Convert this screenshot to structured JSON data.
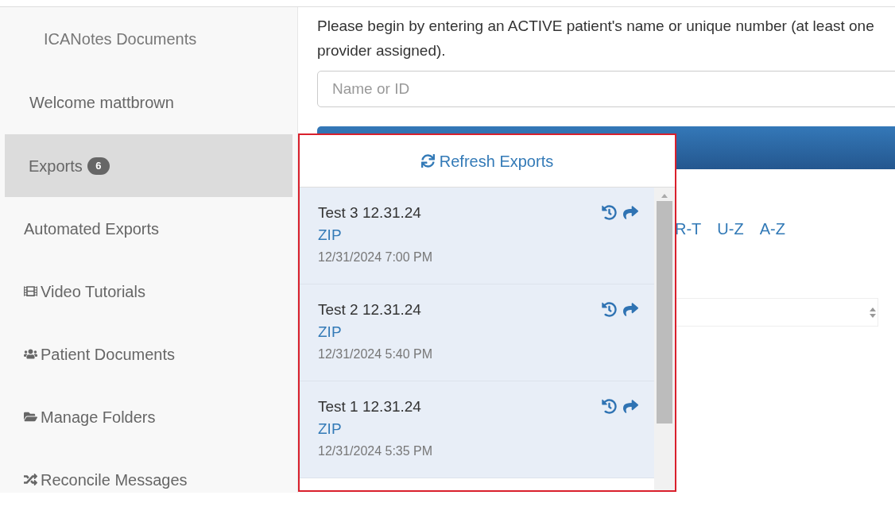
{
  "sidebar": {
    "title": "ICANotes Documents",
    "welcome": "Welcome mattbrown",
    "items": [
      {
        "label": "Exports",
        "kind": "plain",
        "badge": "6",
        "selected": true
      },
      {
        "label": "Automated Exports",
        "kind": "plain",
        "selected": false
      },
      {
        "label": "Video Tutorials",
        "kind": "video",
        "selected": false
      },
      {
        "label": "Patient Documents",
        "kind": "patients",
        "selected": false
      },
      {
        "label": "Manage Folders",
        "kind": "folders",
        "selected": false
      },
      {
        "label": "Reconcile Messages",
        "kind": "reconcile",
        "selected": false
      }
    ]
  },
  "main": {
    "instructions": "Please begin by entering an ACTIVE patient's name or unique number (at least one provider assigned).",
    "search": {
      "placeholder": "Name or ID"
    },
    "filter_links": [
      "R-T",
      "U-Z",
      "A-Z"
    ]
  },
  "exports_popup": {
    "refresh_label": "Refresh Exports",
    "items": [
      {
        "name": "Test 3 12.31.24",
        "format": "ZIP",
        "date": "12/31/2024 7:00 PM"
      },
      {
        "name": "Test 2 12.31.24",
        "format": "ZIP",
        "date": "12/31/2024 5:40 PM"
      },
      {
        "name": "Test 1 12.31.24",
        "format": "ZIP",
        "date": "12/31/2024 5:35 PM"
      }
    ]
  }
}
